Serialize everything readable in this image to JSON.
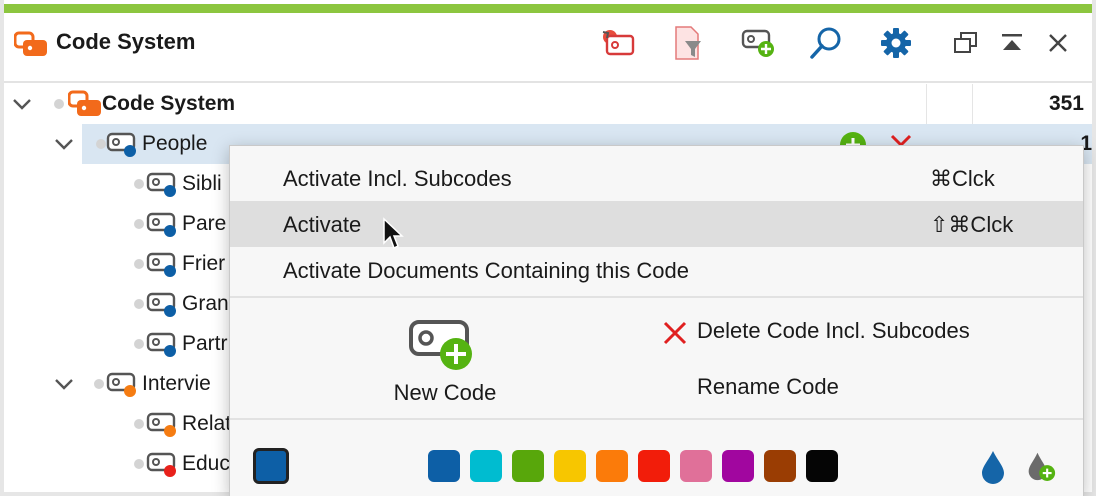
{
  "header": {
    "title": "Code System",
    "toolbar": [
      {
        "icon": "activate-codes-icon"
      },
      {
        "icon": "filter-document-icon"
      },
      {
        "icon": "new-code-icon"
      },
      {
        "icon": "search-icon"
      },
      {
        "icon": "settings-gear-icon"
      },
      {
        "icon": "undock-window-icon"
      },
      {
        "icon": "collapse-panel-icon"
      },
      {
        "icon": "close-icon"
      }
    ]
  },
  "tree": {
    "root": {
      "label": "Code System",
      "count": "351"
    },
    "rows": [
      {
        "label": "People",
        "count": "1",
        "color": "#0d5fa6",
        "level": 1,
        "expandable": true
      },
      {
        "label": "Sibli",
        "color": "#0d5fa6",
        "level": 2
      },
      {
        "label": "Pare",
        "color": "#0d5fa6",
        "level": 2
      },
      {
        "label": "Frier",
        "color": "#0d5fa6",
        "level": 2
      },
      {
        "label": "Gran",
        "color": "#0d5fa6",
        "level": 2
      },
      {
        "label": "Partr",
        "color": "#0d5fa6",
        "level": 2
      },
      {
        "label": "Intervie",
        "color": "#f57c12",
        "level": 1,
        "expandable": true
      },
      {
        "label": "Relat",
        "color": "#f57c12",
        "level": 2
      },
      {
        "label": "Educ",
        "color": "#e8211b",
        "level": 2
      }
    ]
  },
  "menu": {
    "items": [
      {
        "label": "Activate Incl. Subcodes",
        "shortcut": "⌘Clck"
      },
      {
        "label": "Activate",
        "shortcut": "⇧⌘Clck"
      },
      {
        "label": "Activate Documents Containing this Code",
        "shortcut": ""
      }
    ],
    "new_code_label": "New Code",
    "delete_label": "Delete Code Incl. Subcodes",
    "rename_label": "Rename Code",
    "current_color": "#0d5fa6",
    "swatches": [
      "#0d5fa6",
      "#00bcd0",
      "#58a70b",
      "#f7c600",
      "#fb7b0a",
      "#f21d0a",
      "#e07099",
      "#a1069f",
      "#9a3d03",
      "#050505"
    ]
  }
}
